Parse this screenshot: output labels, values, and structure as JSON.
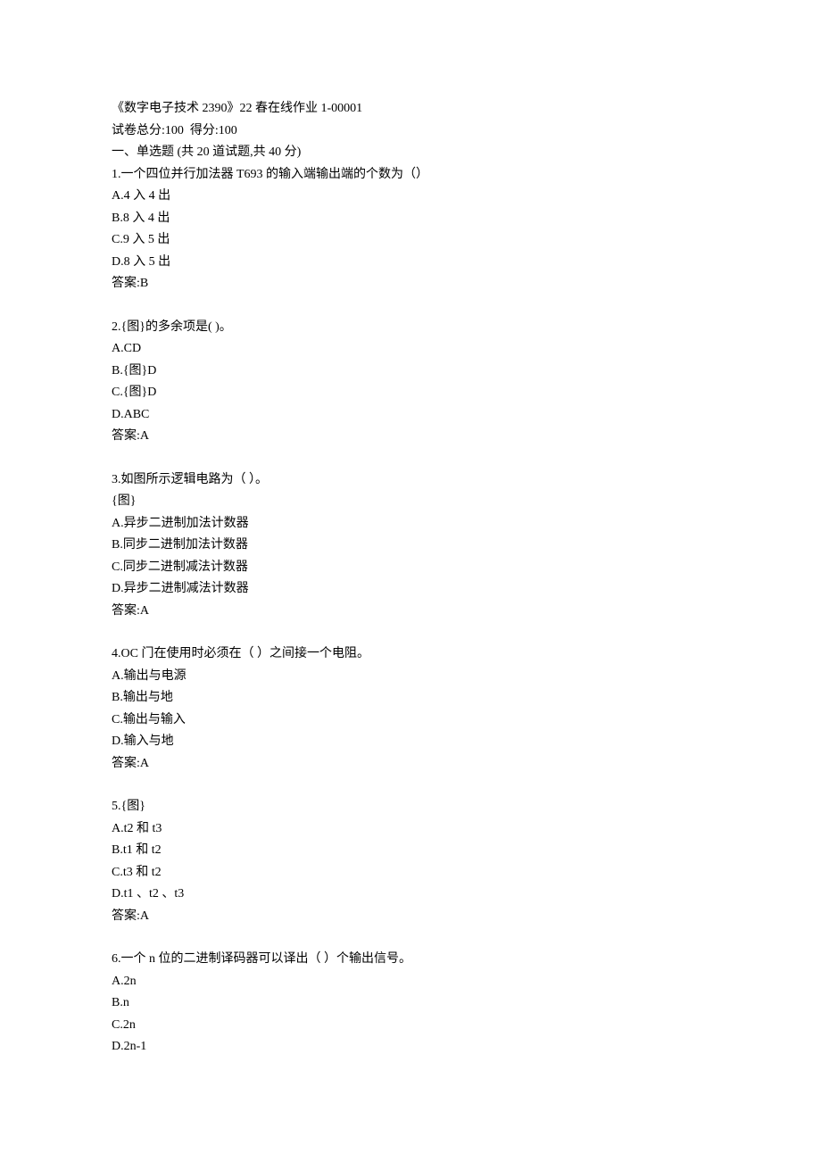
{
  "header": {
    "title": "《数字电子技术 2390》22 春在线作业 1-00001",
    "score_line": "试卷总分:100  得分:100",
    "section_title": "一、单选题 (共 20 道试题,共 40 分)"
  },
  "questions": [
    {
      "num": "1.",
      "stem": "一个四位并行加法器 T693 的输入端输出端的个数为（）",
      "options": [
        "A.4 入 4 出",
        "B.8 入 4 出",
        "C.9 入 5 出",
        "D.8 入 5 出"
      ],
      "answer": "答案:B"
    },
    {
      "num": "2.",
      "stem": "{图}的多余项是( )。",
      "options": [
        "A.CD",
        "B.{图}D",
        "C.{图}D",
        "D.ABC"
      ],
      "answer": "答案:A"
    },
    {
      "num": "3.",
      "stem": "如图所示逻辑电路为（ ）。",
      "extra": "{图}",
      "options": [
        "A.异步二进制加法计数器",
        "B.同步二进制加法计数器",
        "C.同步二进制减法计数器",
        "D.异步二进制减法计数器"
      ],
      "answer": "答案:A"
    },
    {
      "num": "4.",
      "stem": "OC 门在使用时必须在（ ）之间接一个电阻。",
      "options": [
        "A.输出与电源",
        "B.输出与地",
        "C.输出与输入",
        "D.输入与地"
      ],
      "answer": "答案:A"
    },
    {
      "num": "5.",
      "stem": "{图}",
      "options": [
        "A.t2 和 t3",
        "B.t1 和 t2",
        "C.t3 和 t2",
        "D.t1 、t2 、t3"
      ],
      "answer": "答案:A"
    },
    {
      "num": "6.",
      "stem": "一个 n 位的二进制译码器可以译出（ ）个输出信号。",
      "options": [
        "A.2n",
        "B.n",
        "C.2n",
        "D.2n-1"
      ],
      "answer": ""
    }
  ]
}
